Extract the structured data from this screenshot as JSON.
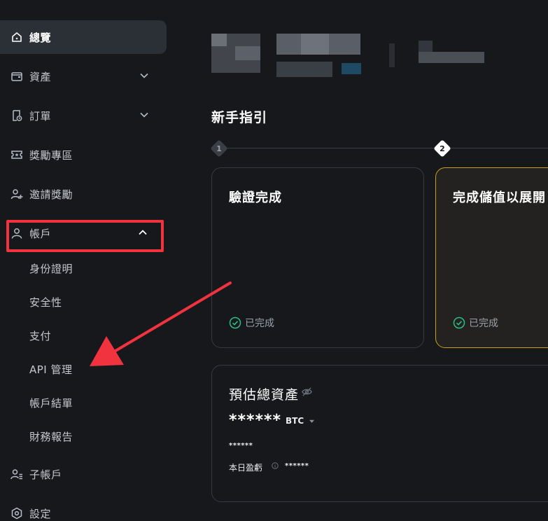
{
  "sidebar": {
    "items": [
      {
        "label": "總覽",
        "icon": "home-icon"
      },
      {
        "label": "資產",
        "icon": "wallet-icon"
      },
      {
        "label": "訂單",
        "icon": "orders-icon"
      },
      {
        "label": "獎勵專區",
        "icon": "ticket-icon"
      },
      {
        "label": "邀請獎勵",
        "icon": "user-plus-icon"
      },
      {
        "label": "帳戶",
        "icon": "user-icon"
      },
      {
        "label": "子帳戶",
        "icon": "sub-account-icon"
      },
      {
        "label": "設定",
        "icon": "settings-icon"
      }
    ],
    "account_sub": [
      "身份證明",
      "安全性",
      "支付",
      "API 管理",
      "帳戶結單",
      "財務報告"
    ]
  },
  "guide": {
    "title": "新手指引",
    "steps": [
      "1",
      "2"
    ],
    "card1_title": "驗證完成",
    "card1_status": "已完成",
    "card2_title": "完成儲值以展開",
    "card2_status": "已完成"
  },
  "assets": {
    "title": "預估總資產",
    "masked_value": "******",
    "currency": "BTC",
    "masked_fiat": "******",
    "pnl_label": "本日盈虧",
    "masked_pnl": "******"
  },
  "colors": {
    "background": "#17181b",
    "active_nav": "#2b2f36",
    "highlight": "#f0333e",
    "success": "#2ebd85",
    "accent_yellow": "#f0b90b"
  }
}
